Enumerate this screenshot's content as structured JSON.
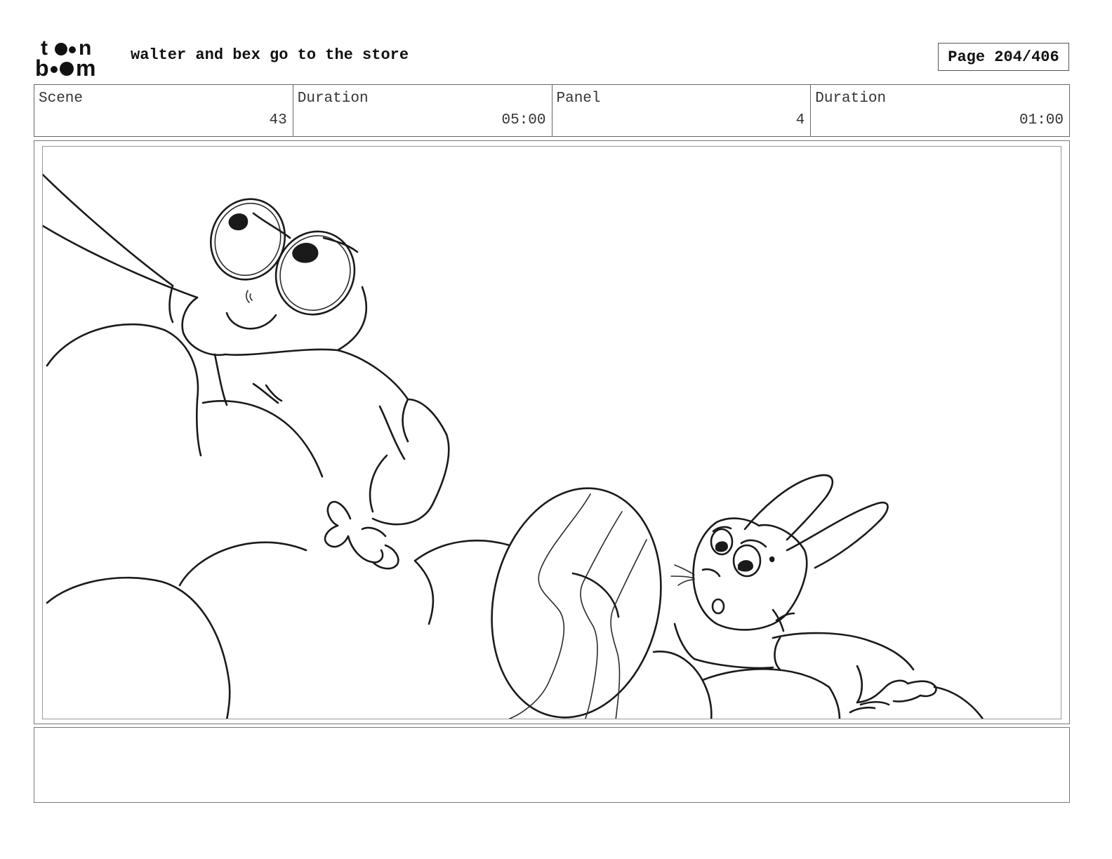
{
  "header": {
    "logo": {
      "text": "toon boom"
    },
    "project_title": "walter and bex go to the store",
    "page_indicator": "Page 204/406"
  },
  "info_bar": {
    "scene_label": "Scene",
    "scene_value": "43",
    "scene_duration_label": "Duration",
    "scene_duration_value": "05:00",
    "panel_label": "Panel",
    "panel_value": "4",
    "panel_duration_label": "Duration",
    "panel_duration_value": "01:00"
  },
  "panel": {
    "image": "pencil-sketch"
  },
  "notes": {
    "text": ""
  }
}
